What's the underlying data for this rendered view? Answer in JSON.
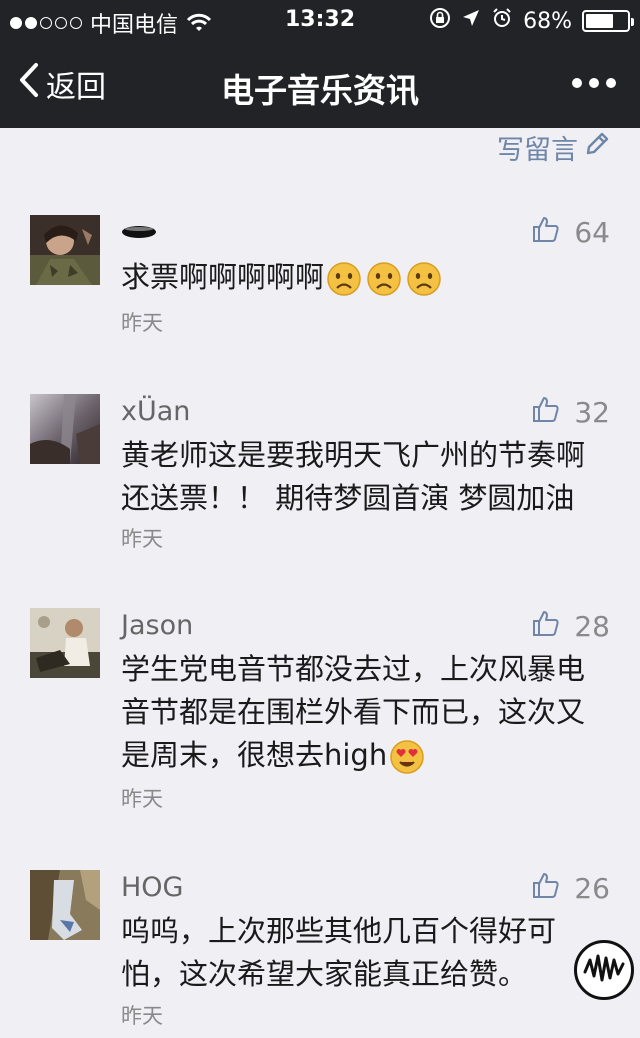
{
  "status_bar": {
    "carrier": "中国电信",
    "time": "13:32",
    "battery": "68%",
    "battery_level": 0.68,
    "signal_bars": 2
  },
  "nav": {
    "back_label": "返回",
    "title": "电子音乐资讯",
    "more_icon": "more-dots-icon"
  },
  "write_comment": {
    "label": "写留言",
    "icon": "pencil-icon"
  },
  "comments": [
    {
      "name": "",
      "likes": "64",
      "content": "求票啊啊啊啊啊",
      "emojis": [
        "sad-face-icon",
        "sad-face-icon",
        "sad-face-icon"
      ],
      "time": "昨天"
    },
    {
      "name": "xÜan",
      "likes": "32",
      "content": "黄老师这是要我明天飞广州的节奏啊还送票！！ 期待梦圆首演 梦圆加油",
      "time": "昨天"
    },
    {
      "name": "Jason",
      "likes": "28",
      "content": "学生党电音节都没去过，上次风暴电音节都是在围栏外看下而已，这次又是周末，很想去high",
      "emojis": [
        "heart-eyes-face-icon"
      ],
      "time": "昨天"
    },
    {
      "name": "HOG",
      "likes": "26",
      "content": "呜呜，上次那些其他几百个得好可怕，这次希望大家能真正给赞。",
      "time": "昨天"
    }
  ],
  "colors": {
    "nav_bg": "#222326",
    "page_bg": "#efeff4",
    "link": "#6f86a8",
    "meta": "#8a8a8a"
  }
}
